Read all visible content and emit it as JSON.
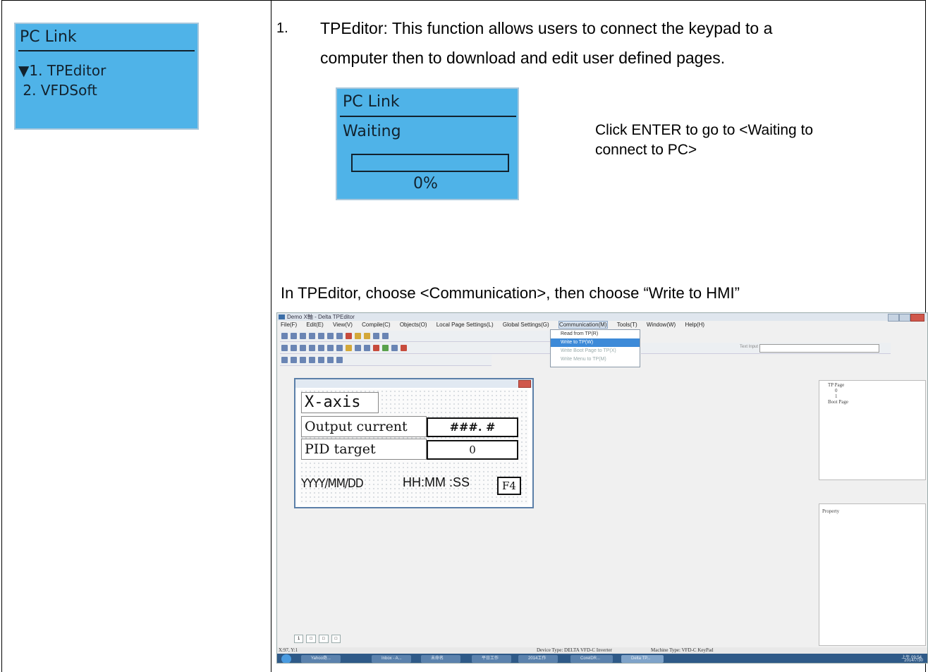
{
  "left_lcd": {
    "title": "PC Link",
    "items": [
      "▼1. TPEditor",
      " 2. VFDSoft"
    ]
  },
  "step": {
    "number": "1.",
    "line1": "TPEditor: This function allows users to connect the keypad to a",
    "line2": "computer then to download and edit user defined pages."
  },
  "waiting_lcd": {
    "title": "PC Link",
    "status": "Waiting",
    "progress_percent": 0,
    "progress_label": "0%"
  },
  "enter_note": {
    "line1": "Click ENTER to go to <Waiting to",
    "line2": "connect to PC>"
  },
  "instruction": "In TPEditor, choose <Communication>, then choose “Write to HMI”",
  "tpeditor": {
    "title": "Demo X軸 - Delta TPEditor",
    "menu": [
      "File(F)",
      "Edit(E)",
      "View(V)",
      "Compile(C)",
      "Objects(O)",
      "Local Page Settings(L)",
      "Global Settings(G)",
      "Communication(M)",
      "Tools(T)",
      "Window(W)",
      "Help(H)"
    ],
    "comm_menu": [
      "Read from TP(R)",
      "Write to TP(W)",
      "Write Boot Page to TP(X)",
      "Write Menu to TP(M)"
    ],
    "text_input_label": "Text Input",
    "page": {
      "title_text": "X-axis",
      "row1_label": "Output current",
      "row1_value": "###. #",
      "row2_label": "PID target",
      "row2_value": "0",
      "date": "YYYY/MM/DD",
      "time": "HH:MM :SS",
      "fkey": "F4"
    },
    "tree": [
      "TP Page",
      "0",
      "1",
      "Boot Page"
    ],
    "property_label": "Property",
    "status_coords": "X:97, Y:1",
    "status_device": "Device Type: DELTA VFD-C Inverter",
    "status_machine": "Machine Type: VFD-C KeyPad",
    "taskbar": [
      "Yahoo奇...",
      "Inbox - A...",
      "未命名",
      "平日工作",
      "2014工作",
      "CorelDR...",
      "Delta TP..."
    ],
    "clock": [
      "上午 09:54",
      "2014/7/30"
    ]
  }
}
